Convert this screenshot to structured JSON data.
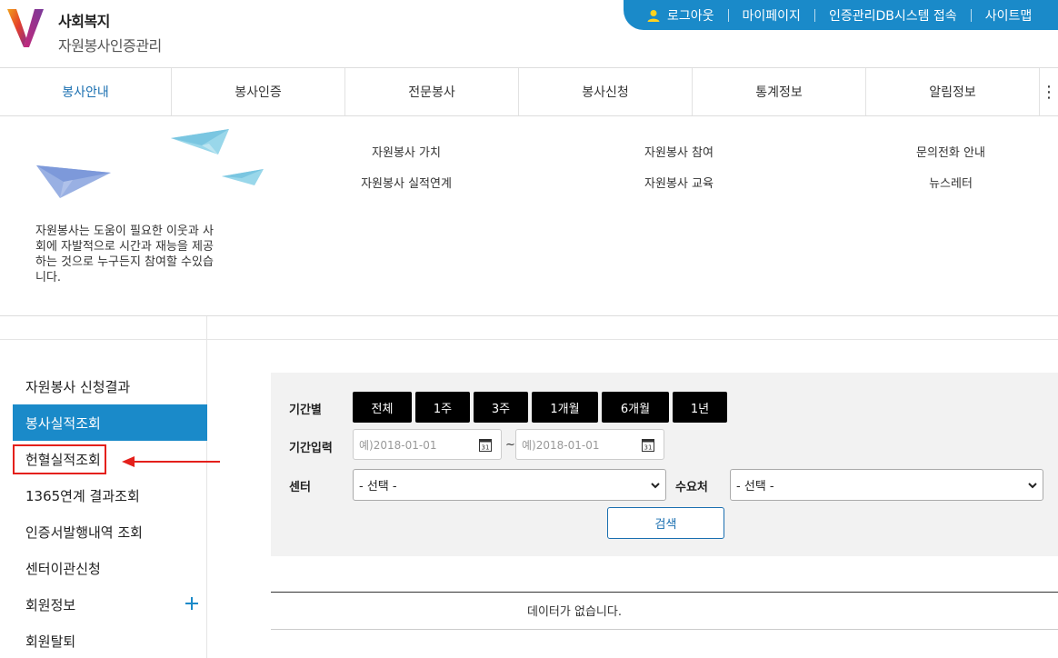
{
  "header": {
    "logo_line1": "사회복지",
    "logo_line2": "자원봉사인증관리",
    "util_links": [
      "로그아웃",
      "마이페이지",
      "인증관리DB시스템 접속",
      "사이트맵"
    ]
  },
  "gnb": {
    "items": [
      "봉사안내",
      "봉사인증",
      "전문봉사",
      "봉사신청",
      "통계정보",
      "알림정보"
    ],
    "more_label": "⋮"
  },
  "mega": {
    "description": "자원봉사는 도움이 필요한 이웃과 사회에 자발적으로 시간과 재능을 제공하는 것으로 누구든지 참여할 수있습니다.",
    "links": [
      "자원봉사 가치",
      "자원봉사 실적연계",
      "자원봉사 참여",
      "자원봉사 교육",
      "문의전화 안내",
      "뉴스레터"
    ]
  },
  "lnb": {
    "items": [
      "자원봉사 신청결과",
      "봉사실적조회",
      "헌혈실적조회",
      "1365연계 결과조회",
      "인증서발행내역 조회",
      "센터이관신청",
      "회원정보",
      "회원탈퇴"
    ]
  },
  "search": {
    "period_label": "기간별",
    "period_buttons": [
      "전체",
      "1주",
      "3주",
      "1개월",
      "6개월",
      "1년"
    ],
    "date_label": "기간입력",
    "date_from_placeholder": "예)2018-01-01",
    "date_to_placeholder": "예)2018-01-01",
    "date_sep": "~",
    "calendar_day": "31",
    "center_label": "센터",
    "center_selected": "- 선택 -",
    "demand_label": "수요처",
    "demand_selected": "- 선택 -",
    "search_button": "검색"
  },
  "result": {
    "no_data": "데이터가 없습니다."
  },
  "colors": {
    "brand_blue": "#1a8ac9",
    "highlight_red": "#e4201b"
  }
}
